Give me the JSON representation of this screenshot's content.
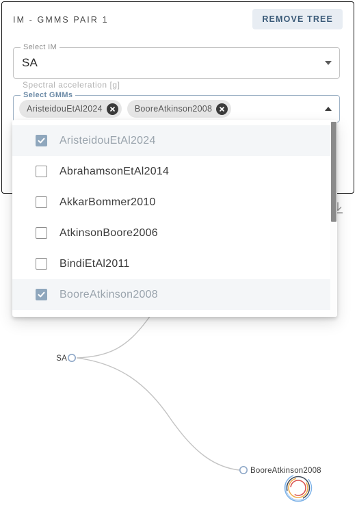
{
  "card": {
    "title": "IM - GMMS PAIR 1",
    "remove_button_label": "REMOVE TREE"
  },
  "select_im": {
    "legend": "Select IM",
    "value": "SA",
    "helper_text": "Spectral acceleration [g]",
    "caret_icon": "chevron-down-icon"
  },
  "select_gmms": {
    "legend": "Select GMMs",
    "caret_icon": "chevron-up-icon",
    "chips": [
      {
        "label": "AristeidouEtAl2024",
        "delete_icon": "close-circle-icon"
      },
      {
        "label": "BooreAtkinson2008",
        "delete_icon": "close-circle-icon"
      }
    ],
    "options": [
      {
        "label": "AristeidouEtAl2024",
        "checked": true
      },
      {
        "label": "AbrahamsonEtAl2014",
        "checked": false
      },
      {
        "label": "AkkarBommer2010",
        "checked": false
      },
      {
        "label": "AtkinsonBoore2006",
        "checked": false
      },
      {
        "label": "BindiEtAl2011",
        "checked": false
      },
      {
        "label": "BooreAtkinson2008",
        "checked": true
      },
      {
        "label": "",
        "checked": false
      }
    ]
  },
  "toolbar": {
    "download_icon": "download-icon"
  },
  "tree": {
    "root_label": "SA",
    "leaf_labels": [
      "BooreAtkinson2008"
    ],
    "node_stroke_color": "#8fa8c8",
    "link_color": "#c4c4c4"
  },
  "spinner": {
    "name": "loading-spinner",
    "colors": [
      "#7fb3e8",
      "#e8833a",
      "#3f4a5a",
      "#d9534f",
      "#f0ad4e"
    ]
  },
  "theme": {
    "accent": "#6b8aa6",
    "button_bg": "#e8edf3",
    "button_text": "#3a5a78",
    "checkbox_checked": "#8fa7bd"
  }
}
